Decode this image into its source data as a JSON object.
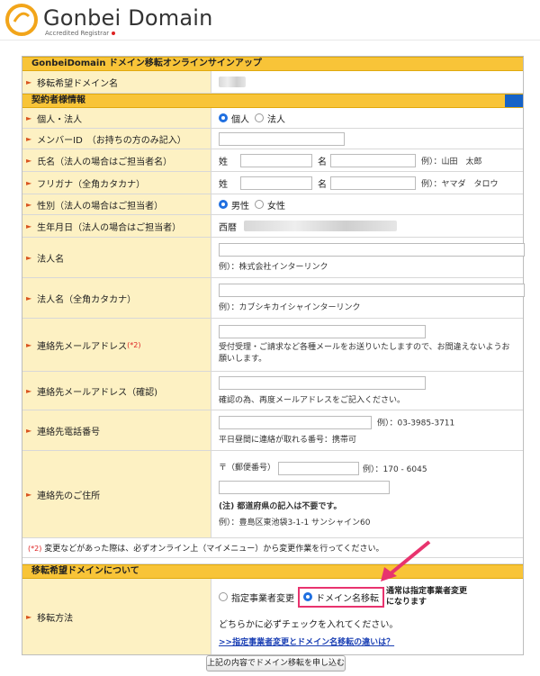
{
  "logo": {
    "title": "Gonbei Domain",
    "subtitle": "Accredited Registrar"
  },
  "form_title": "GonbeiDomain ドメイン移転オンラインサインアップ",
  "domain_row": {
    "label": "移転希望ドメイン名"
  },
  "contract_section": "契約者様情報",
  "rows": {
    "type": {
      "label": "個人・法人",
      "opt1": "個人",
      "opt2": "法人"
    },
    "member": {
      "label": "メンバーID　（お持ちの方のみ記入）"
    },
    "name": {
      "label": "氏名（法人の場合はご担当者名）",
      "sei": "姓",
      "mei": "名",
      "example": "例）：山田　太郎"
    },
    "furigana": {
      "label": "フリガナ（全角カタカナ）",
      "sei": "姓",
      "mei": "名",
      "example": "例）：ヤマダ　タロウ"
    },
    "gender": {
      "label": "性別（法人の場合はご担当者）",
      "opt1": "男性",
      "opt2": "女性"
    },
    "birth": {
      "label": "生年月日（法人の場合はご担当者）",
      "era": "西暦"
    },
    "corp": {
      "label": "法人名",
      "example": "例）：株式会社インターリンク"
    },
    "corp_kana": {
      "label": "法人名（全角カタカナ）",
      "example": "例）：カブシキカイシャインターリンク"
    },
    "email": {
      "label": "連絡先メールアドレス",
      "req": "(*2)",
      "note": "受付受理・ご請求など各種メールをお送りいたしますので、お間違えないようお願いします。"
    },
    "email_confirm": {
      "label": "連絡先メールアドレス（確認)",
      "note": "確認の為、再度メールアドレスをご記入ください。"
    },
    "phone": {
      "label": "連絡先電話番号",
      "example": "例）：03-3985-3711",
      "note": "平日昼間に連絡が取れる番号：携帯可"
    },
    "address": {
      "label": "連絡先のご住所",
      "zip_label": "〒（郵便番号）",
      "zip_example": "例）：170 - 6045",
      "note_bold": "(注) 都道府県の記入は不要です。",
      "example": "例）：豊島区東池袋3-1-1 サンシャイン60"
    }
  },
  "footnote": {
    "mark": "(*2)",
    "text": "変更などがあった際は、必ずオンライン上（マイメニュー）から変更作業を行ってください。"
  },
  "transfer_section": "移転希望ドメインについて",
  "transfer": {
    "label": "移転方法",
    "opt1": "指定事業者変更",
    "opt2": "ドメイン名移転",
    "side_note_1": "通常は指定事業者変更",
    "side_note_2": "になります",
    "instruction": "どちらかに必ずチェックを入れてください。",
    "link": ">>指定事業者変更とドメイン名移転の違いは？"
  },
  "submit": "上記の内容でドメイン移転を申し込む",
  "colors": {
    "section": "#f8c438",
    "label_bg": "#fdf1c3",
    "accent_blue": "#1663c7",
    "highlight": "#e8336e"
  }
}
